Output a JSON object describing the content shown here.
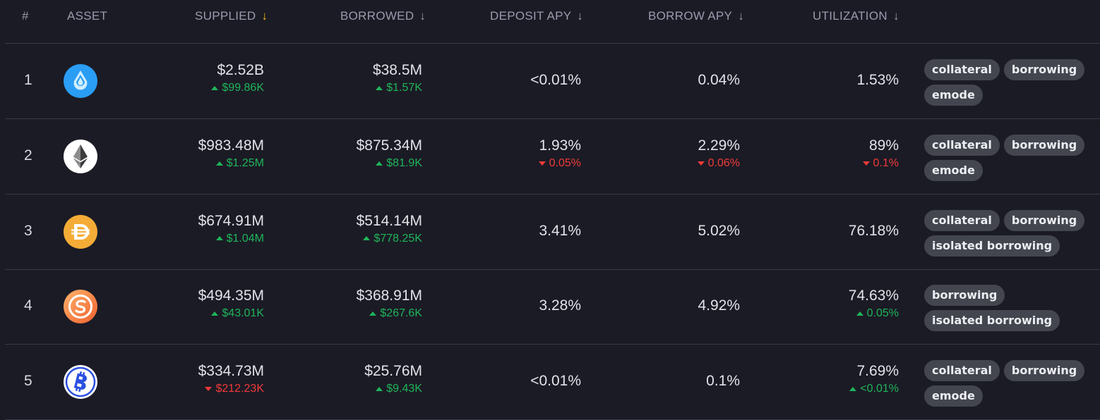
{
  "header": {
    "num": "#",
    "asset": "ASSET",
    "supplied": "SUPPLIED",
    "borrowed": "BORROWED",
    "deposit_apy": "DEPOSIT APY",
    "borrow_apy": "BORROW APY",
    "utilization": "UTILIZATION",
    "sort_arrow": "↓"
  },
  "colors": {
    "background": "#1b1b25",
    "positive": "#1fb55a",
    "negative": "#f23a3a",
    "active_sort": "#f3b41c",
    "tag_bg": "#44464f"
  },
  "rows": [
    {
      "num": "1",
      "icon": "blue-drop-icon",
      "supplied": "$2.52B",
      "supplied_change": "$99.86K",
      "supplied_dir": "up",
      "borrowed": "$38.5M",
      "borrowed_change": "$1.57K",
      "borrowed_dir": "up",
      "deposit_apy": "<0.01%",
      "deposit_change": "",
      "deposit_dir": "",
      "borrow_apy": "0.04%",
      "borrow_change": "",
      "borrow_dir": "",
      "utilization": "1.53%",
      "util_change": "",
      "util_dir": "",
      "tags": [
        "collateral",
        "borrowing",
        "emode"
      ]
    },
    {
      "num": "2",
      "icon": "ethereum-icon",
      "supplied": "$983.48M",
      "supplied_change": "$1.25M",
      "supplied_dir": "up",
      "borrowed": "$875.34M",
      "borrowed_change": "$81.9K",
      "borrowed_dir": "up",
      "deposit_apy": "1.93%",
      "deposit_change": "0.05%",
      "deposit_dir": "down",
      "borrow_apy": "2.29%",
      "borrow_change": "0.06%",
      "borrow_dir": "down",
      "utilization": "89%",
      "util_change": "0.1%",
      "util_dir": "down",
      "tags": [
        "collateral",
        "borrowing",
        "emode"
      ]
    },
    {
      "num": "3",
      "icon": "dai-icon",
      "supplied": "$674.91M",
      "supplied_change": "$1.04M",
      "supplied_dir": "up",
      "borrowed": "$514.14M",
      "borrowed_change": "$778.25K",
      "borrowed_dir": "up",
      "deposit_apy": "3.41%",
      "deposit_change": "",
      "deposit_dir": "",
      "borrow_apy": "5.02%",
      "borrow_change": "",
      "borrow_dir": "",
      "utilization": "76.18%",
      "util_change": "",
      "util_dir": "",
      "tags": [
        "collateral",
        "borrowing",
        "isolated borrowing"
      ]
    },
    {
      "num": "4",
      "icon": "orange-s-coin-icon",
      "supplied": "$494.35M",
      "supplied_change": "$43.01K",
      "supplied_dir": "up",
      "borrowed": "$368.91M",
      "borrowed_change": "$267.6K",
      "borrowed_dir": "up",
      "deposit_apy": "3.28%",
      "deposit_change": "",
      "deposit_dir": "",
      "borrow_apy": "4.92%",
      "borrow_change": "",
      "borrow_dir": "",
      "utilization": "74.63%",
      "util_change": "0.05%",
      "util_dir": "up",
      "tags": [
        "borrowing",
        "isolated borrowing"
      ]
    },
    {
      "num": "5",
      "icon": "bitcoin-icon",
      "supplied": "$334.73M",
      "supplied_change": "$212.23K",
      "supplied_dir": "down",
      "borrowed": "$25.76M",
      "borrowed_change": "$9.43K",
      "borrowed_dir": "up",
      "deposit_apy": "<0.01%",
      "deposit_change": "",
      "deposit_dir": "",
      "borrow_apy": "0.1%",
      "borrow_change": "",
      "borrow_dir": "",
      "utilization": "7.69%",
      "util_change": "<0.01%",
      "util_dir": "up",
      "tags": [
        "collateral",
        "borrowing",
        "emode"
      ]
    }
  ]
}
